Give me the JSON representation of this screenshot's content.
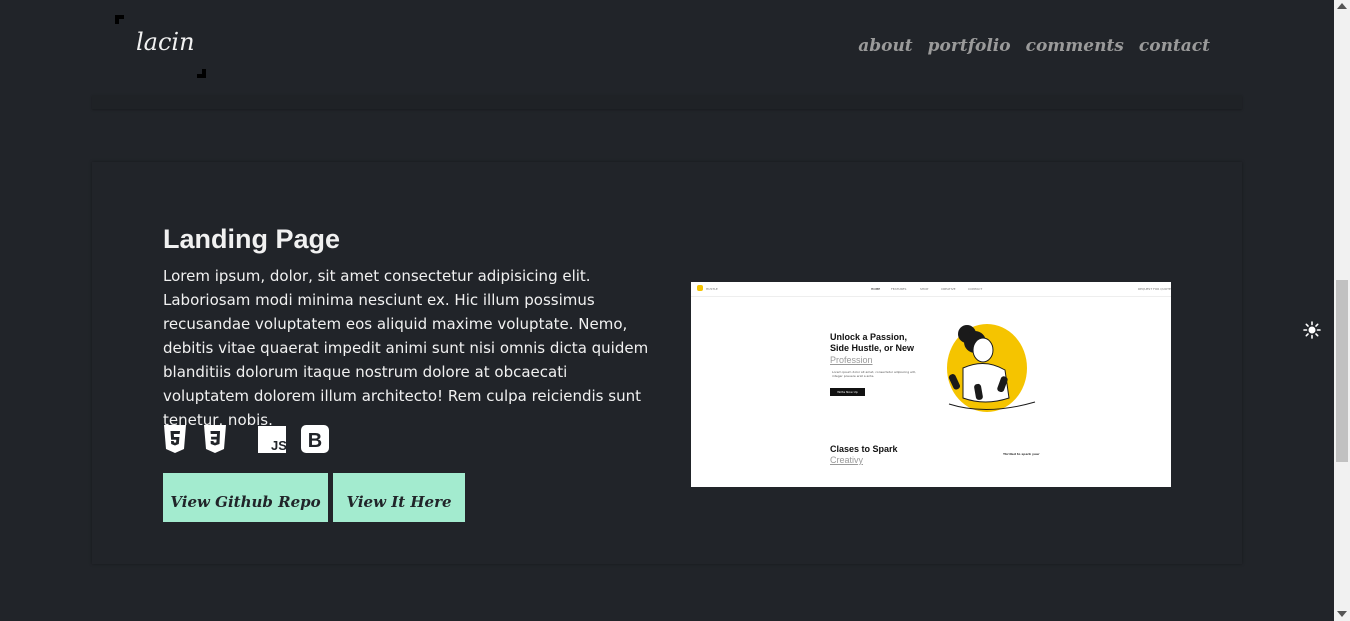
{
  "header": {
    "logo": "lacin",
    "nav": [
      "about",
      "portfolio",
      "comments",
      "contact"
    ]
  },
  "project": {
    "title": "Landing Page",
    "description": "Lorem ipsum, dolor, sit amet consectetur adipisicing elit. Laboriosam modi minima nesciunt ex. Hic illum possimus recusandae voluptatem eos aliquid maxime voluptate. Nemo, debitis vitae quaerat impedit animi sunt nisi omnis dicta quidem blanditiis dolorum itaque nostrum dolore at obcaecati voluptatem dolorem illum architecto! Rem culpa reiciendis sunt tenetur, nobis.",
    "tech_icons": [
      "html5-icon",
      "css3-icon",
      "javascript-icon",
      "bootstrap-icon"
    ],
    "tech_labels": {
      "js": "JS",
      "bootstrap": "B"
    },
    "buttons": {
      "github": "View Github Repo",
      "live": "View It Here"
    },
    "button_color": "#a3ebcf",
    "preview": {
      "nav": [
        "HOME",
        "FEATURES",
        "SHOP",
        "CREATIVE",
        "CONTACT"
      ],
      "brand": "HUSTLE",
      "cta_top": "REQUEST FOR QUOTE",
      "hero_line1": "Unlock a Passion,",
      "hero_line2": "Side Hustle, or New",
      "hero_profession": "Profession",
      "hero_text": "Lorem ipsum dolor sit amet, consectetur adipiscing elit, integer posuere erat a ante.",
      "hero_button": "Write Now Up",
      "classes_title": "Clases to Spark",
      "classes_sub": "Creativy",
      "thrill": "Thrilled to spark your"
    }
  },
  "theme_toggle_icon": "sun-icon",
  "colors": {
    "background": "#212429",
    "text": "#f1f1f1",
    "nav_text": "#9a9a9a"
  }
}
